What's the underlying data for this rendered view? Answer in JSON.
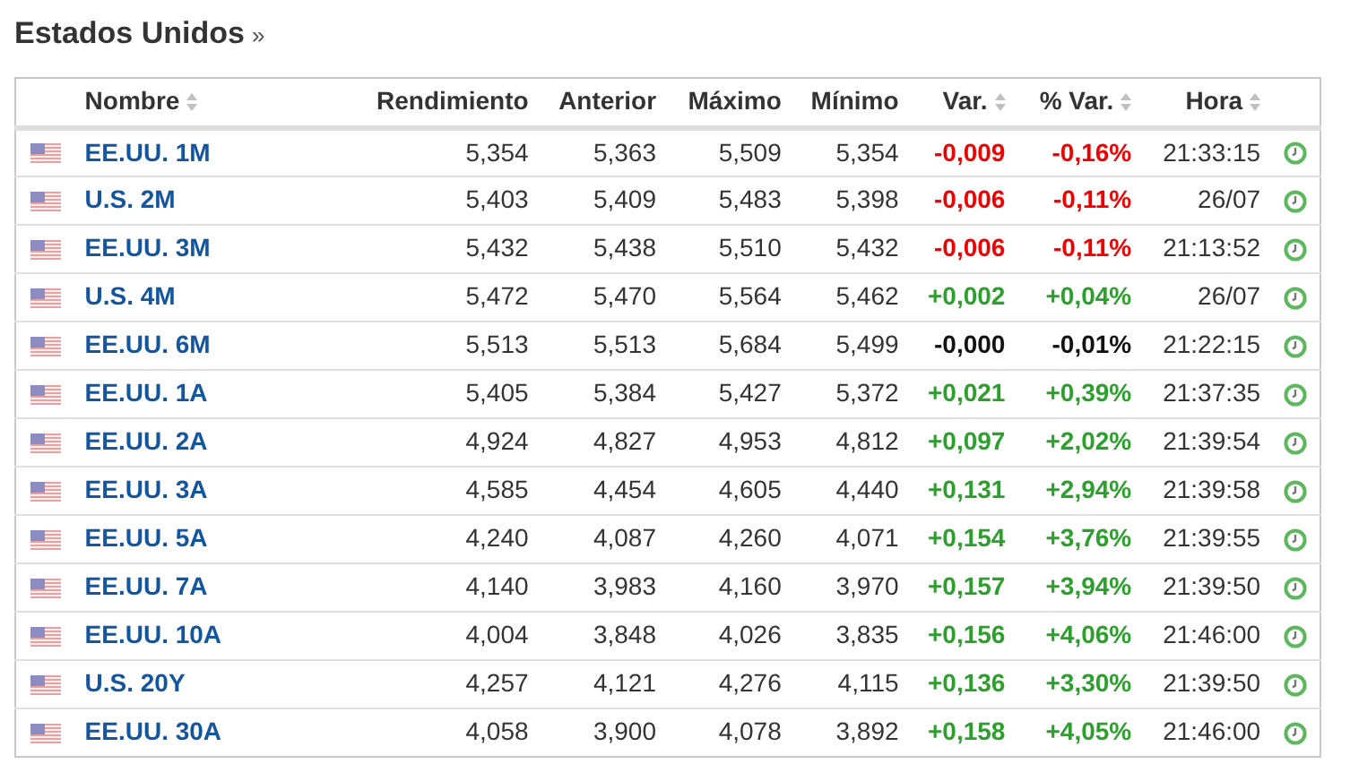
{
  "title": "Estados Unidos",
  "title_link": "»",
  "columns": [
    {
      "label": "Nombre",
      "sortable": true
    },
    {
      "label": "Rendimiento",
      "sortable": false
    },
    {
      "label": "Anterior",
      "sortable": false
    },
    {
      "label": "Máximo",
      "sortable": false
    },
    {
      "label": "Mínimo",
      "sortable": false
    },
    {
      "label": "Var.",
      "sortable": true
    },
    {
      "label": "% Var.",
      "sortable": true
    },
    {
      "label": "Hora",
      "sortable": true
    }
  ],
  "rows": [
    {
      "name": "EE.UU. 1M",
      "yield": "5,354",
      "prev": "5,363",
      "high": "5,509",
      "low": "5,354",
      "chg": "-0,009",
      "pct": "-0,16%",
      "time": "21:33:15",
      "color": "#ee0000"
    },
    {
      "name": "U.S. 2M",
      "yield": "5,403",
      "prev": "5,409",
      "high": "5,483",
      "low": "5,398",
      "chg": "-0,006",
      "pct": "-0,11%",
      "time": "26/07",
      "color": "#ee0000"
    },
    {
      "name": "EE.UU. 3M",
      "yield": "5,432",
      "prev": "5,438",
      "high": "5,510",
      "low": "5,432",
      "chg": "-0,006",
      "pct": "-0,11%",
      "time": "21:13:52",
      "color": "#ee0000"
    },
    {
      "name": "U.S. 4M",
      "yield": "5,472",
      "prev": "5,470",
      "high": "5,564",
      "low": "5,462",
      "chg": "+0,002",
      "pct": "+0,04%",
      "time": "26/07",
      "color": "#2ba02b"
    },
    {
      "name": "EE.UU. 6M",
      "yield": "5,513",
      "prev": "5,513",
      "high": "5,684",
      "low": "5,499",
      "chg": "-0,000",
      "pct": "-0,01%",
      "time": "21:22:15",
      "color": "#111111"
    },
    {
      "name": "EE.UU. 1A",
      "yield": "5,405",
      "prev": "5,384",
      "high": "5,427",
      "low": "5,372",
      "chg": "+0,021",
      "pct": "+0,39%",
      "time": "21:37:35",
      "color": "#2ba02b"
    },
    {
      "name": "EE.UU. 2A",
      "yield": "4,924",
      "prev": "4,827",
      "high": "4,953",
      "low": "4,812",
      "chg": "+0,097",
      "pct": "+2,02%",
      "time": "21:39:54",
      "color": "#2ba02b"
    },
    {
      "name": "EE.UU. 3A",
      "yield": "4,585",
      "prev": "4,454",
      "high": "4,605",
      "low": "4,440",
      "chg": "+0,131",
      "pct": "+2,94%",
      "time": "21:39:58",
      "color": "#2ba02b"
    },
    {
      "name": "EE.UU. 5A",
      "yield": "4,240",
      "prev": "4,087",
      "high": "4,260",
      "low": "4,071",
      "chg": "+0,154",
      "pct": "+3,76%",
      "time": "21:39:55",
      "color": "#2ba02b"
    },
    {
      "name": "EE.UU. 7A",
      "yield": "4,140",
      "prev": "3,983",
      "high": "4,160",
      "low": "3,970",
      "chg": "+0,157",
      "pct": "+3,94%",
      "time": "21:39:50",
      "color": "#2ba02b"
    },
    {
      "name": "EE.UU. 10A",
      "yield": "4,004",
      "prev": "3,848",
      "high": "4,026",
      "low": "3,835",
      "chg": "+0,156",
      "pct": "+4,06%",
      "time": "21:46:00",
      "color": "#2ba02b"
    },
    {
      "name": "U.S. 20Y",
      "yield": "4,257",
      "prev": "4,121",
      "high": "4,276",
      "low": "4,115",
      "chg": "+0,136",
      "pct": "+3,30%",
      "time": "21:39:50",
      "color": "#2ba02b"
    },
    {
      "name": "EE.UU. 30A",
      "yield": "4,058",
      "prev": "3,900",
      "high": "4,078",
      "low": "3,892",
      "chg": "+0,158",
      "pct": "+4,05%",
      "time": "21:46:00",
      "color": "#2ba02b"
    }
  ]
}
